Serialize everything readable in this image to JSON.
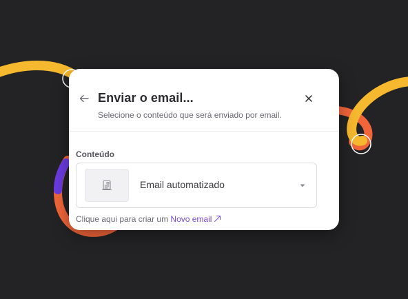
{
  "colors": {
    "background": "#232325",
    "modal_bg": "#ffffff",
    "accent_link": "#7c4ddb",
    "decor_yellow": "#f5b82e",
    "decor_orange": "#f0653a",
    "decor_purple": "#6a3be0"
  },
  "modal": {
    "title": "Enviar o email...",
    "subtitle": "Selecione o conteúdo que será enviado por email.",
    "back_icon": "arrow-left-icon",
    "close_icon": "close-icon"
  },
  "content_field": {
    "label": "Conteúdo",
    "selected_value": "Email automatizado",
    "thumbnail_icon": "email-template-icon",
    "caret_icon": "caret-down-icon"
  },
  "helper": {
    "text": "Clique aqui para criar um ",
    "link_label": "Novo email",
    "link_icon": "external-link-icon"
  }
}
